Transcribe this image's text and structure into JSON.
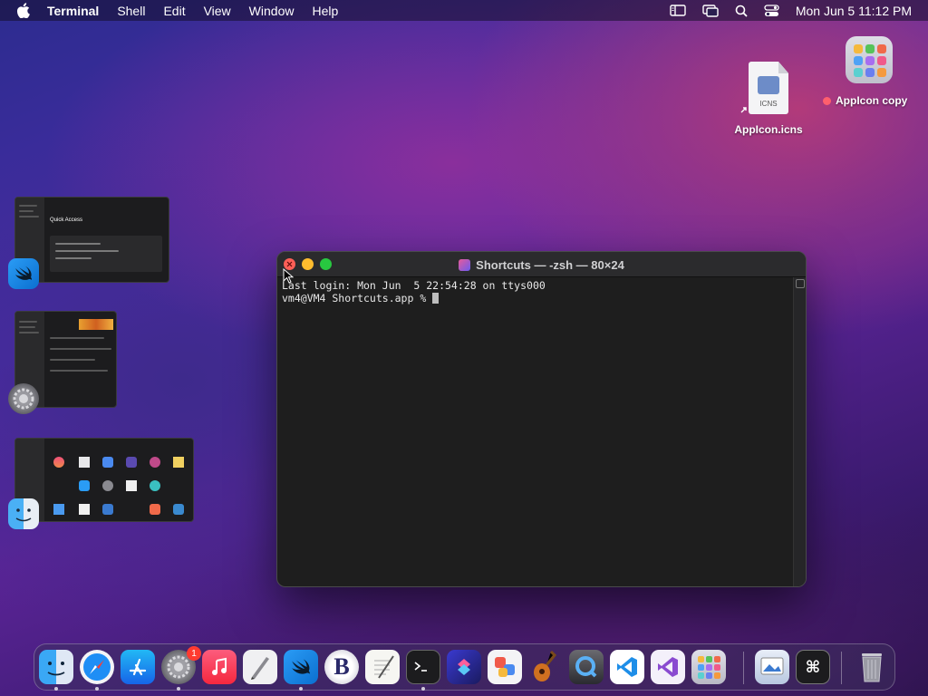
{
  "menubar": {
    "app_name": "Terminal",
    "menus": [
      "Shell",
      "Edit",
      "View",
      "Window",
      "Help"
    ],
    "clock": "Mon Jun 5  11:12 PM",
    "status_icons": [
      "sidebar-icon",
      "screen-mirroring-icon",
      "search-icon",
      "control-center-icon"
    ]
  },
  "desktop": {
    "icns_file": {
      "name": "AppIcon.icns",
      "badge_text": "ICNS"
    },
    "appicon_copy": {
      "name": "AppIcon copy",
      "tag_color": "#ff5f6d"
    }
  },
  "stage_manager": [
    {
      "app": "Xcode-like app",
      "icon": "swift-icon",
      "thumb_title": "Quick Access"
    },
    {
      "app": "System Settings",
      "icon": "settings-icon"
    },
    {
      "app": "Finder",
      "icon": "finder-icon"
    }
  ],
  "terminal": {
    "title": "Shortcuts — -zsh — 80×24",
    "lines": [
      "Last login: Mon Jun  5 22:54:28 on ttys000",
      "vm4@VM4 Shortcuts.app % "
    ]
  },
  "dock": {
    "apps": [
      {
        "name": "Finder",
        "icon": "finder-icon",
        "running": true
      },
      {
        "name": "Safari",
        "icon": "safari-icon",
        "running": true
      },
      {
        "name": "App Store",
        "icon": "app-store-icon",
        "running": false
      },
      {
        "name": "System Settings",
        "icon": "settings-icon",
        "running": true,
        "badge": "1"
      },
      {
        "name": "Music",
        "icon": "music-icon",
        "running": false
      },
      {
        "name": "Script Editor",
        "icon": "script-editor-icon",
        "running": false
      },
      {
        "name": "Swift Playgrounds",
        "icon": "swift-icon",
        "running": true
      },
      {
        "name": "BBEdit",
        "icon": "bbedit-icon",
        "running": false
      },
      {
        "name": "TextEdit",
        "icon": "textedit-icon",
        "running": false
      },
      {
        "name": "Terminal",
        "icon": "terminal-icon",
        "running": true
      },
      {
        "name": "Shortcuts",
        "icon": "shortcuts-icon",
        "running": false
      },
      {
        "name": "Icon Composer",
        "icon": "icon-composer-icon",
        "running": false
      },
      {
        "name": "GarageBand",
        "icon": "guitar-icon",
        "running": false
      },
      {
        "name": "QuickTime",
        "icon": "quicktime-icon",
        "running": false
      },
      {
        "name": "Visual Studio Code",
        "icon": "vscode-icon",
        "running": false
      },
      {
        "name": "Visual Studio",
        "icon": "visual-studio-icon",
        "running": false
      },
      {
        "name": "Launchpad",
        "icon": "launchpad-icon",
        "running": false
      },
      {
        "name": "Preview",
        "icon": "preview-icon",
        "running": false
      },
      {
        "name": "Shortcut app",
        "icon": "command-icon",
        "running": false
      },
      {
        "name": "Trash",
        "icon": "trash-icon",
        "running": false
      }
    ]
  }
}
